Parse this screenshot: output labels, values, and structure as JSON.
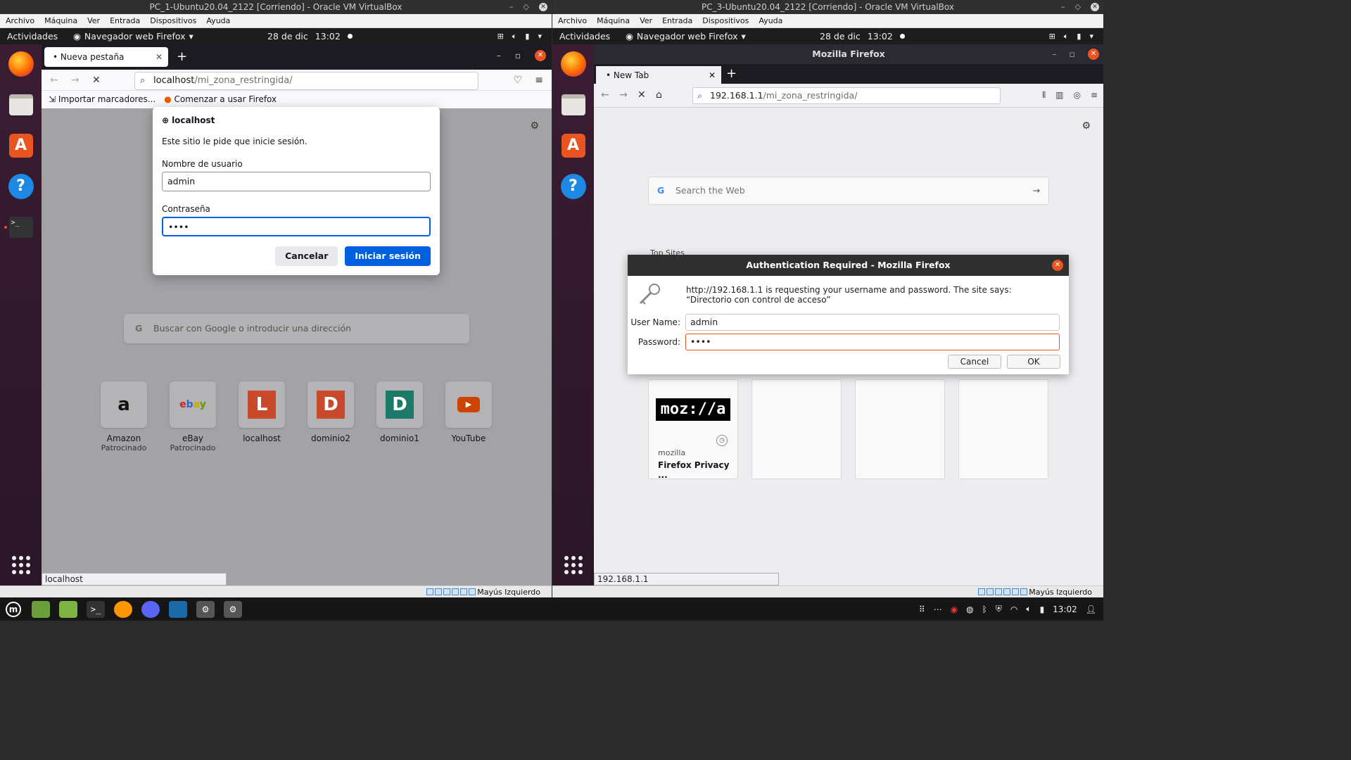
{
  "vm1": {
    "window_title": "PC_1-Ubuntu20.04_2122 [Corriendo] - Oracle VM VirtualBox",
    "menu": [
      "Archivo",
      "Máquina",
      "Ver",
      "Entrada",
      "Dispositivos",
      "Ayuda"
    ],
    "gnome": {
      "activities": "Actividades",
      "app_name": "Navegador web Firefox",
      "date": "28 de dic",
      "time": "13:02"
    },
    "firefox": {
      "tab_title": "Nueva pestaña",
      "url_host": "localhost",
      "url_path": "/mi_zona_restringida/",
      "bookmarks": [
        "Importar marcadores...",
        "Comenzar a usar Firefox"
      ],
      "search_placeholder": "Buscar con Google o introducir una dirección",
      "tiles": [
        {
          "label": "Amazon",
          "sub": "Patrocinado"
        },
        {
          "label": "eBay",
          "sub": "Patrocinado"
        },
        {
          "label": "localhost",
          "sub": ""
        },
        {
          "label": "dominio2",
          "sub": ""
        },
        {
          "label": "dominio1",
          "sub": ""
        },
        {
          "label": "YouTube",
          "sub": ""
        }
      ],
      "status_url": "localhost"
    },
    "login": {
      "host": "localhost",
      "message": "Este sitio le pide que inicie sesión.",
      "user_label": "Nombre de usuario",
      "user_value": "admin",
      "pass_label": "Contraseña",
      "pass_value": "••••",
      "cancel": "Cancelar",
      "submit": "Iniciar sesión"
    },
    "statusbar": "Mayús Izquierdo"
  },
  "vm2": {
    "window_title": "PC_3-Ubuntu20.04_2122 [Corriendo] - Oracle VM VirtualBox",
    "menu": [
      "Archivo",
      "Máquina",
      "Ver",
      "Entrada",
      "Dispositivos",
      "Ayuda"
    ],
    "gnome": {
      "activities": "Actividades",
      "app_name": "Navegador web Firefox",
      "date": "28 de dic",
      "time": "13:02"
    },
    "firefox": {
      "window_title": "Mozilla Firefox",
      "tab_title": "New Tab",
      "url_host": "192.168.1.1",
      "url_path": "/mi_zona_restringida/",
      "search_placeholder": "Search the Web",
      "top_sites_label": "Top Sites",
      "card": {
        "logo": "moz://a",
        "host": "mozilla",
        "title": "Firefox Privacy ..."
      },
      "status_url": "192.168.1.1"
    },
    "auth": {
      "title": "Authentication Required - Mozilla Firefox",
      "message": "http://192.168.1.1 is requesting your username and password. The site says: “Directorio con control de acceso”",
      "user_label": "User Name:",
      "user_value": "admin",
      "pass_label": "Password:",
      "pass_value": "••••",
      "cancel": "Cancel",
      "ok": "OK"
    },
    "statusbar": "Mayús Izquierdo"
  },
  "host": {
    "time": "13:02"
  }
}
